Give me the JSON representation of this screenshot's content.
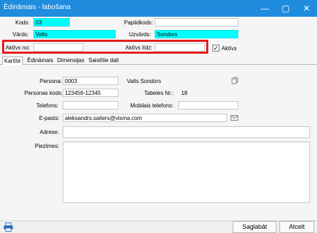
{
  "window": {
    "title": "Ēdināmais - labošana",
    "minimize": "—",
    "maximize": "▢",
    "close": "✕"
  },
  "top_fields": {
    "kods_label": "Kods:",
    "kods_value": "03",
    "papildkods_label": "Papildkods:",
    "papildkods_value": "",
    "vards_label": "Vārds:",
    "vards_value": "Valts",
    "uzvards_label": "Uzvārds:",
    "uzvards_value": "Sondors",
    "aktivs_no_label": "Aktīvs no:",
    "aktivs_no_value": "",
    "aktivs_lidz_label": "Aktīvs līdz:",
    "aktivs_lidz_value": "",
    "aktivs_checkbox_label": "Aktīvs",
    "aktivs_checked": true,
    "check_mark": "✓"
  },
  "tabs": [
    {
      "label": "Kartīte",
      "active": true
    },
    {
      "label": "Ēdināmais",
      "active": false
    },
    {
      "label": "Dimensijas",
      "active": false
    },
    {
      "label": "Saistītie dati",
      "active": false
    }
  ],
  "details": {
    "persona_label": "Persona:",
    "persona_code": "0003",
    "persona_name": "Valts Sondors",
    "personas_kods_label": "Personas kods:",
    "personas_kods_value": "123456-12345",
    "tabeles_nr_label": "Tabeles Nr.:",
    "tabeles_nr_value": "18",
    "telefons_label": "Telefons:",
    "telefons_value": "",
    "mobilais_label": "Mobilais telefons:",
    "mobilais_value": "",
    "epasts_label": "E-pasts:",
    "epasts_value": "aleksandrs.saiters@visma.com",
    "adrese_label": "Adrese:",
    "adrese_value": "",
    "piezimes_label": "Piezīmes:",
    "piezimes_value": ""
  },
  "buttons": {
    "save": "Saglabāt",
    "cancel": "Atcelt"
  },
  "icons": {
    "print": "print-icon",
    "copy": "copy-icon",
    "email": "email-icon"
  }
}
